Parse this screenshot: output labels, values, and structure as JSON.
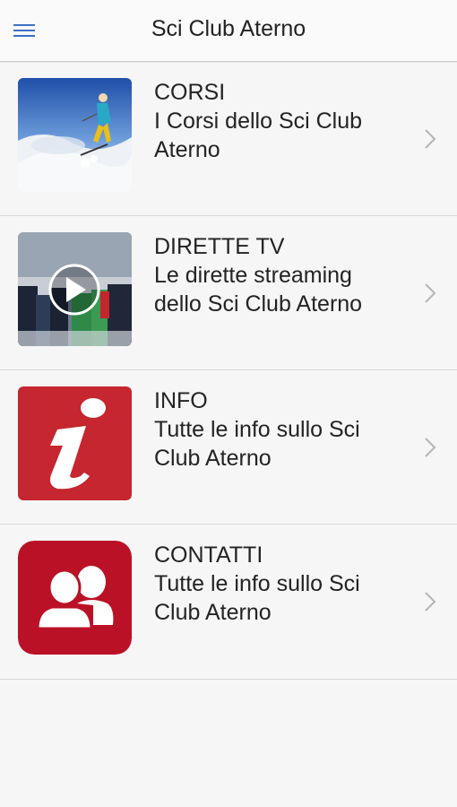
{
  "header": {
    "title": "Sci Club Aterno",
    "menu_icon": "hamburger-menu-icon"
  },
  "items": [
    {
      "title": "CORSI",
      "subtitle": "I Corsi dello Sci Club Aterno",
      "image": "skier-photo",
      "chevron_icon": "chevron-right-icon"
    },
    {
      "title": "DIRETTE TV",
      "subtitle": "Le dirette streaming dello Sci Club Aterno",
      "image": "video-thumbnail-with-play-icon",
      "chevron_icon": "chevron-right-icon"
    },
    {
      "title": "INFO",
      "subtitle": "Tutte le info sullo Sci Club Aterno",
      "image": "info-icon",
      "chevron_icon": "chevron-right-icon"
    },
    {
      "title": "CONTATTI",
      "subtitle": "Tutte le info sullo Sci Club Aterno",
      "image": "contacts-people-icon",
      "chevron_icon": "chevron-right-icon"
    }
  ],
  "colors": {
    "accent": "#3f6fc6",
    "info_red": "#c6262f",
    "contacts_red": "#bb1126",
    "background": "#f6f6f6"
  }
}
